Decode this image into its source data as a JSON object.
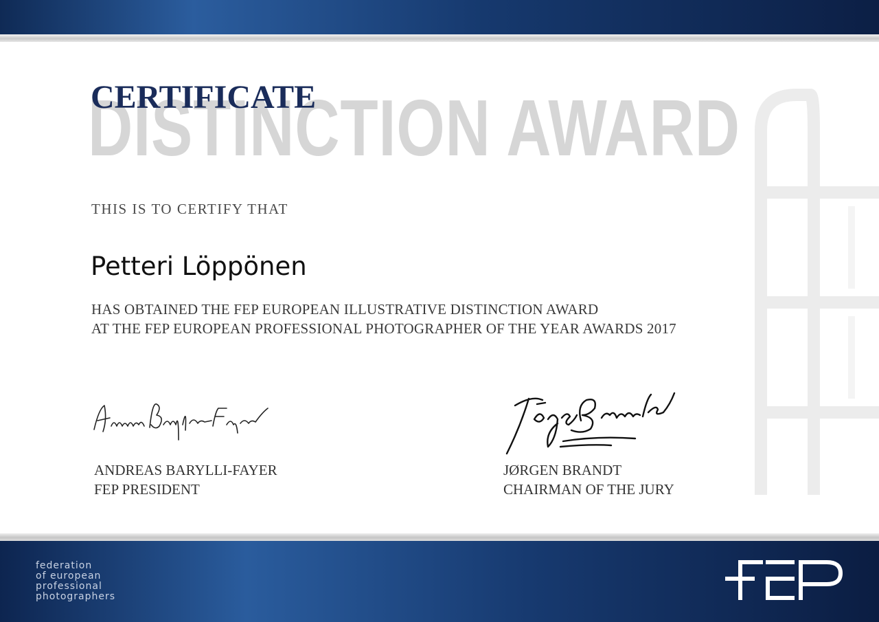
{
  "certificate": {
    "heading": "CERTIFICATE",
    "award_title": "DISTINCTION AWARD",
    "certify_text": "THIS IS TO CERTIFY THAT",
    "recipient": "Petteri Löppönen",
    "award_lines": [
      "HAS OBTAINED THE FEP EUROPEAN ILLUSTRATIVE DISTINCTION AWARD",
      "AT THE FEP EUROPEAN PROFESSIONAL PHOTOGRAPHER OF THE YEAR AWARDS 2017"
    ]
  },
  "signatories": [
    {
      "name": "ANDREAS BARYLLI-FAYER",
      "title": "FEP PRESIDENT",
      "signature_script": "Andreas Barylli-Fayer"
    },
    {
      "name": "JØRGEN BRANDT",
      "title": "CHAIRMAN OF THE JURY",
      "signature_script": "Jørgen Brandt"
    }
  ],
  "footer": {
    "org_lines": [
      "federation",
      "of european",
      "professional",
      "photographers"
    ],
    "logo_text": "FEP"
  },
  "colors": {
    "navy": "#16396e",
    "heading": "#1a2c5a",
    "watermark_gray": "#d6d6d6"
  }
}
